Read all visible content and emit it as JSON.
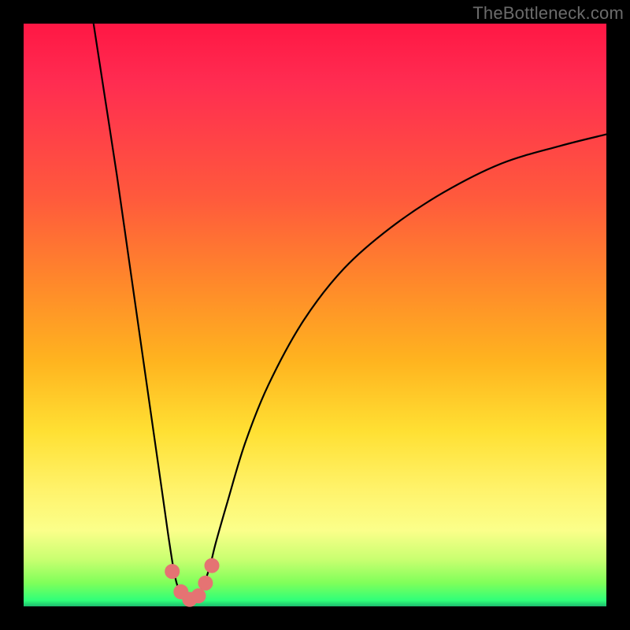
{
  "watermark": "TheBottleneck.com",
  "colors": {
    "frame_bg": "#000000",
    "gradient_top": "#ff1744",
    "gradient_mid1": "#ff8a2a",
    "gradient_mid2": "#ffe033",
    "gradient_bottom": "#1dbb6e",
    "curve": "#000000",
    "marker": "#e57373"
  },
  "chart_data": {
    "type": "line",
    "title": "",
    "xlabel": "",
    "ylabel": "",
    "xlim": [
      0,
      100
    ],
    "ylim": [
      0,
      100
    ],
    "series": [
      {
        "name": "bottleneck-curve",
        "x": [
          12,
          14,
          16,
          18,
          20,
          22,
          24,
          25,
          26,
          27,
          28,
          29,
          30,
          31,
          32,
          33,
          35,
          38,
          42,
          48,
          55,
          63,
          72,
          82,
          92,
          100
        ],
        "values": [
          100,
          87,
          74,
          60,
          46,
          32,
          18,
          11,
          5,
          2,
          1,
          1,
          2,
          4,
          7,
          11,
          18,
          28,
          38,
          49,
          58,
          65,
          71,
          76,
          79,
          81
        ]
      }
    ],
    "markers": {
      "name": "highlight-points",
      "x": [
        25.5,
        27.0,
        28.5,
        30.0,
        31.2,
        32.3
      ],
      "values": [
        6.0,
        2.5,
        1.2,
        1.8,
        4.0,
        7.0
      ]
    },
    "grid": false,
    "legend": false
  }
}
